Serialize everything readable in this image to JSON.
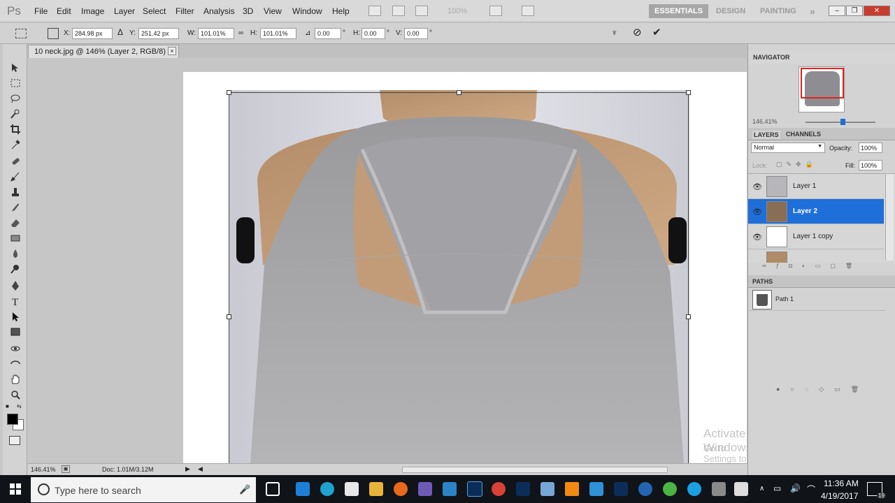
{
  "app": {
    "logo": "Ps"
  },
  "menu": [
    "File",
    "Edit",
    "Image",
    "Layer",
    "Select",
    "Filter",
    "Analysis",
    "3D",
    "View",
    "Window",
    "Help"
  ],
  "menubar": {
    "zoom": "100%"
  },
  "workspaces": {
    "essentials": "ESSENTIALS",
    "design": "DESIGN",
    "painting": "PAINTING",
    "more": "»"
  },
  "options": {
    "x_label": "X:",
    "x_value": "284.98 px",
    "y_label": "Y:",
    "y_value": "251.42 px",
    "w_label": "W:",
    "w_value": "101.01%",
    "h_label": "H:",
    "h_value": "101.01%",
    "angle_value": "0.00",
    "angle_unit": "°",
    "hskew_label": "H:",
    "hskew_value": "0.00",
    "hskew_unit": "°",
    "vskew_label": "V:",
    "vskew_value": "0.00",
    "vskew_unit": "°"
  },
  "document": {
    "tab_title": "10 neck.jpg @ 146% (Layer 2, RGB/8) *",
    "close": "×"
  },
  "status": {
    "zoom": "146.41%",
    "doc": "Doc: 1.01M/3.12M"
  },
  "navigator": {
    "title": "NAVIGATOR",
    "zoom": "146.41%"
  },
  "layers_panel": {
    "tab_layers": "LAYERS",
    "tab_channels": "CHANNELS",
    "blend_mode": "Normal",
    "opacity_label": "Opacity:",
    "opacity": "100%",
    "lock_label": "Lock:",
    "fill_label": "Fill:",
    "fill": "100%",
    "layers": [
      {
        "name": "Layer 1",
        "selected": false
      },
      {
        "name": "Layer 2",
        "selected": true
      },
      {
        "name": "Layer 1 copy",
        "selected": false
      }
    ]
  },
  "paths_panel": {
    "title": "PATHS",
    "paths": [
      {
        "name": "Path 1"
      }
    ]
  },
  "watermark": {
    "line1": "Activate Windows",
    "line2": "Go to Settings to activate Windows."
  },
  "taskbar": {
    "search_placeholder": "Type here to search",
    "time": "11:36 AM",
    "date": "4/19/2017",
    "notifications": "19"
  },
  "colors": {
    "selected_layer": "#1e6fd9",
    "taskbar": "#101318",
    "menubar": "#d9d9d9"
  }
}
